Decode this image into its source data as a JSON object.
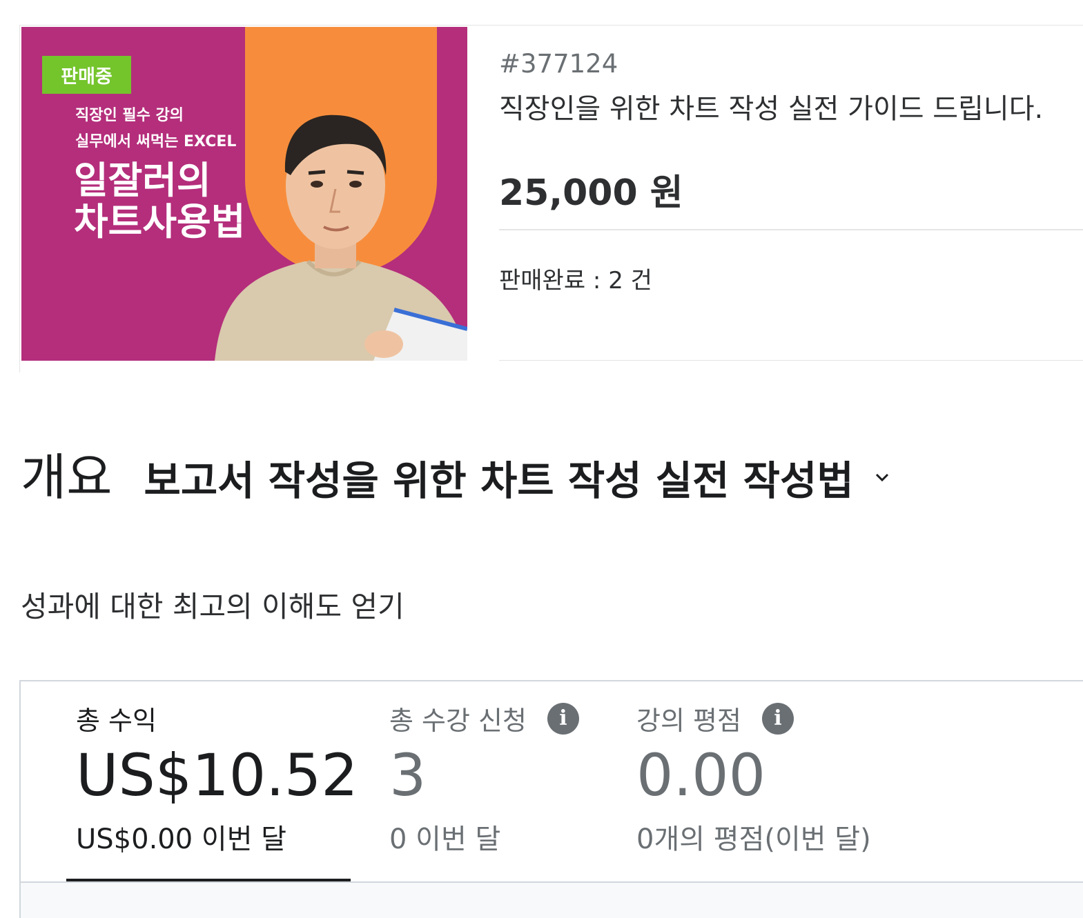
{
  "product": {
    "thumbnail": {
      "status_badge": "판매중",
      "subtitle_line1": "직장인 필수 강의",
      "subtitle_line2": "실무에서 써먹는 EXCEL",
      "title_line1": "일잘러의",
      "title_line2": "차트사용법",
      "bg_color": "#b42e7b",
      "accent_color": "#f78d3c",
      "badge_color": "#74c42b"
    },
    "id": "#377124",
    "title": "직장인을 위한 차트 작성 실전 가이드 드립니다.",
    "price": "25,000 원",
    "sold": "판매완료 : 2 건"
  },
  "overview": {
    "title": "개요",
    "course_name": "보고서 작성을 위한 차트 작성 실전 작성법",
    "dropdown_icon": "chevron-down-icon",
    "subtitle": "성과에 대한 최고의 이해도 얻기"
  },
  "stats": [
    {
      "label": "총 수익",
      "value": "US$10.52",
      "sub": "US$0.00 이번 달",
      "active": true
    },
    {
      "label": "총 수강 신청",
      "value": "3",
      "sub": "0 이번 달",
      "info_icon": "info-icon"
    },
    {
      "label": "강의 평점",
      "value": "0.00",
      "sub": "0개의 평점(이번 달)",
      "info_icon": "info-icon"
    }
  ],
  "info_glyph": "i"
}
